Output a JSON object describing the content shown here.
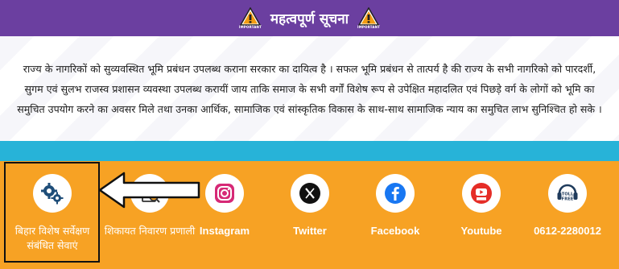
{
  "header": {
    "title": "महत्वपूर्ण सूचना",
    "icon_tag": "IMPORTANT",
    "background": "#6b3fa0"
  },
  "notice": {
    "text": "राज्य के नागरिकों को सुव्यवस्थित भूमि प्रबंधन उपलब्ध कराना सरकार का दायित्व है । सफल भूमि प्रबंधन से तात्पर्य है की राज्य के सभी नागरिको को पारदर्शी, सुगम एवं सुलभ राजस्व प्रशासन व्यवस्था उपलब्ध करायीं जाय ताकि समाज के सभी वर्गों विशेष रूप से उपेक्षित महादलित एवं पिछड़े वर्ग के लोगों को भूमि का समुचित उपयोग करने का अवसर मिले तथा उनका आर्थिक, सामाजिक एवं सांस्कृतिक विकास के साथ-साथ सामाजिक न्याय का समुचित लाभ सुनिश्चित हो सके ।"
  },
  "services": [
    {
      "label": "बिहार विशेष सर्वेक्षण संबंधित सेवाएं",
      "icon": "gears-icon"
    },
    {
      "label": "शिकायत निवारण प्रणाली",
      "icon": "grievance-icon"
    },
    {
      "label": "Instagram",
      "icon": "instagram-icon"
    },
    {
      "label": "Twitter",
      "icon": "x-twitter-icon"
    },
    {
      "label": "Facebook",
      "icon": "facebook-icon"
    },
    {
      "label": "Youtube",
      "icon": "youtube-icon"
    },
    {
      "label": "0612-2280012",
      "icon": "toll-free-phone-icon",
      "icon_text": "TOLL FREE"
    }
  ],
  "colors": {
    "services_bg": "#f7a224",
    "band": "#27b3d8",
    "instagram": "#d62976",
    "facebook": "#1877f2",
    "youtube": "#e52d27"
  }
}
